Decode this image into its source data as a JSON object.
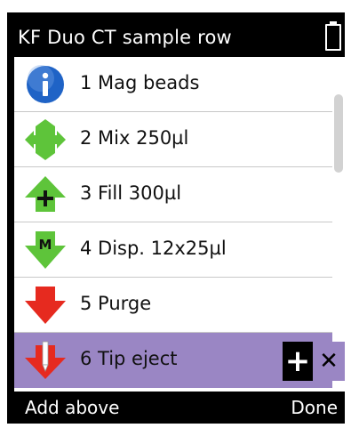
{
  "header": {
    "title": "KF Duo CT sample row",
    "battery_icon": "battery-icon"
  },
  "steps": [
    {
      "label": "1  Mag beads",
      "icon": "info-icon",
      "color": "#1f63c6"
    },
    {
      "label": "2  Mix 250µl",
      "icon": "mix-icon",
      "color": "#5ec43a"
    },
    {
      "label": "3  Fill 300µl",
      "icon": "fill-icon",
      "color": "#5ec43a"
    },
    {
      "label": "4  Disp. 12x25µl",
      "icon": "dispense-icon",
      "color": "#5ec43a"
    },
    {
      "label": "5  Purge",
      "icon": "purge-icon",
      "color": "#e62a1f"
    },
    {
      "label": "6  Tip eject",
      "icon": "tip-eject-icon",
      "color": "#e62a1f",
      "selected": true
    }
  ],
  "actions": {
    "add_glyph": "+",
    "delete_glyph": "✕"
  },
  "softkeys": {
    "left": "Add above",
    "right": "Done"
  },
  "colors": {
    "selection": "#9a86c4",
    "accent_green": "#5ec43a",
    "accent_red": "#e62a1f",
    "accent_blue": "#1f63c6"
  }
}
